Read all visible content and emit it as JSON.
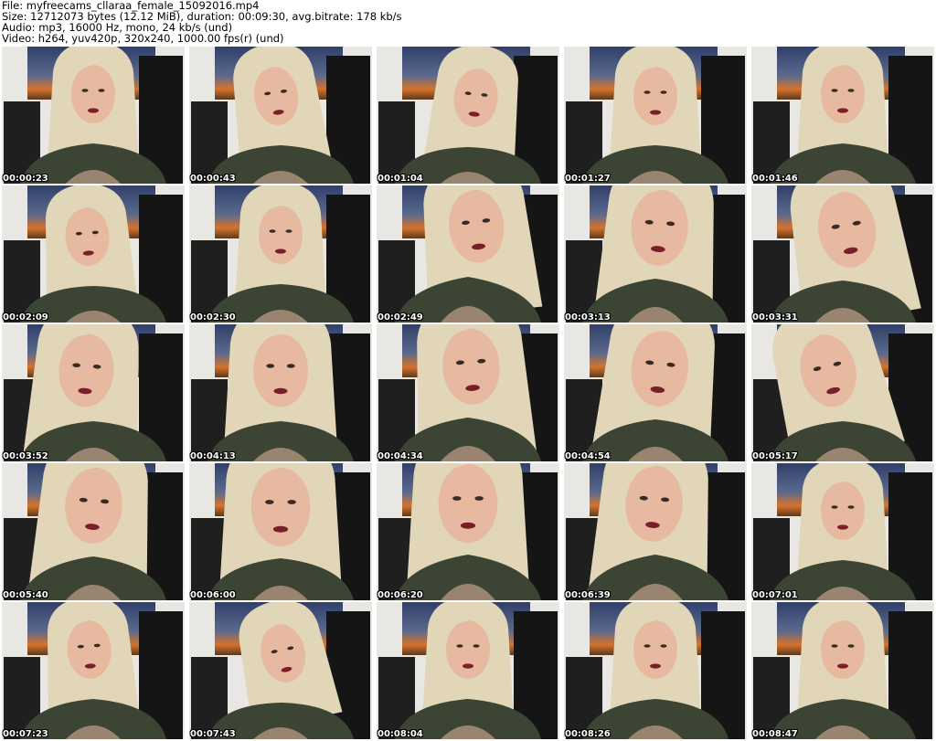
{
  "header": {
    "file_line": "File: myfreecams_cllaraa_female_15092016.mp4",
    "size_line": "Size: 12712073 bytes (12.12 MiB), duration: 00:09:30, avg.bitrate: 178 kb/s",
    "audio_line": "Audio: mp3, 16000 Hz, mono, 24 kb/s (und)",
    "video_line": "Video: h264, yuv420p, 320x240, 1000.00 fps(r) (und)"
  },
  "thumbnails": [
    {
      "timestamp": "00:00:23"
    },
    {
      "timestamp": "00:00:43"
    },
    {
      "timestamp": "00:01:04"
    },
    {
      "timestamp": "00:01:27"
    },
    {
      "timestamp": "00:01:46"
    },
    {
      "timestamp": "00:02:09"
    },
    {
      "timestamp": "00:02:30"
    },
    {
      "timestamp": "00:02:49"
    },
    {
      "timestamp": "00:03:13"
    },
    {
      "timestamp": "00:03:31"
    },
    {
      "timestamp": "00:03:52"
    },
    {
      "timestamp": "00:04:13"
    },
    {
      "timestamp": "00:04:34"
    },
    {
      "timestamp": "00:04:54"
    },
    {
      "timestamp": "00:05:17"
    },
    {
      "timestamp": "00:05:40"
    },
    {
      "timestamp": "00:06:00"
    },
    {
      "timestamp": "00:06:20"
    },
    {
      "timestamp": "00:06:39"
    },
    {
      "timestamp": "00:07:01"
    },
    {
      "timestamp": "00:07:23"
    },
    {
      "timestamp": "00:07:43"
    },
    {
      "timestamp": "00:08:04"
    },
    {
      "timestamp": "00:08:26"
    },
    {
      "timestamp": "00:08:47"
    }
  ],
  "colors": {
    "wall": "#e9e7e3",
    "poster_sky": "#2f3f6a",
    "poster_sunset": "#d6732c",
    "chair": "#151515",
    "hair": "#e2d6b8",
    "skin": "#e6b9a0",
    "shirt": "#3c4434",
    "lips": "#7a1e2a",
    "timestamp_text": "#ffffff"
  }
}
